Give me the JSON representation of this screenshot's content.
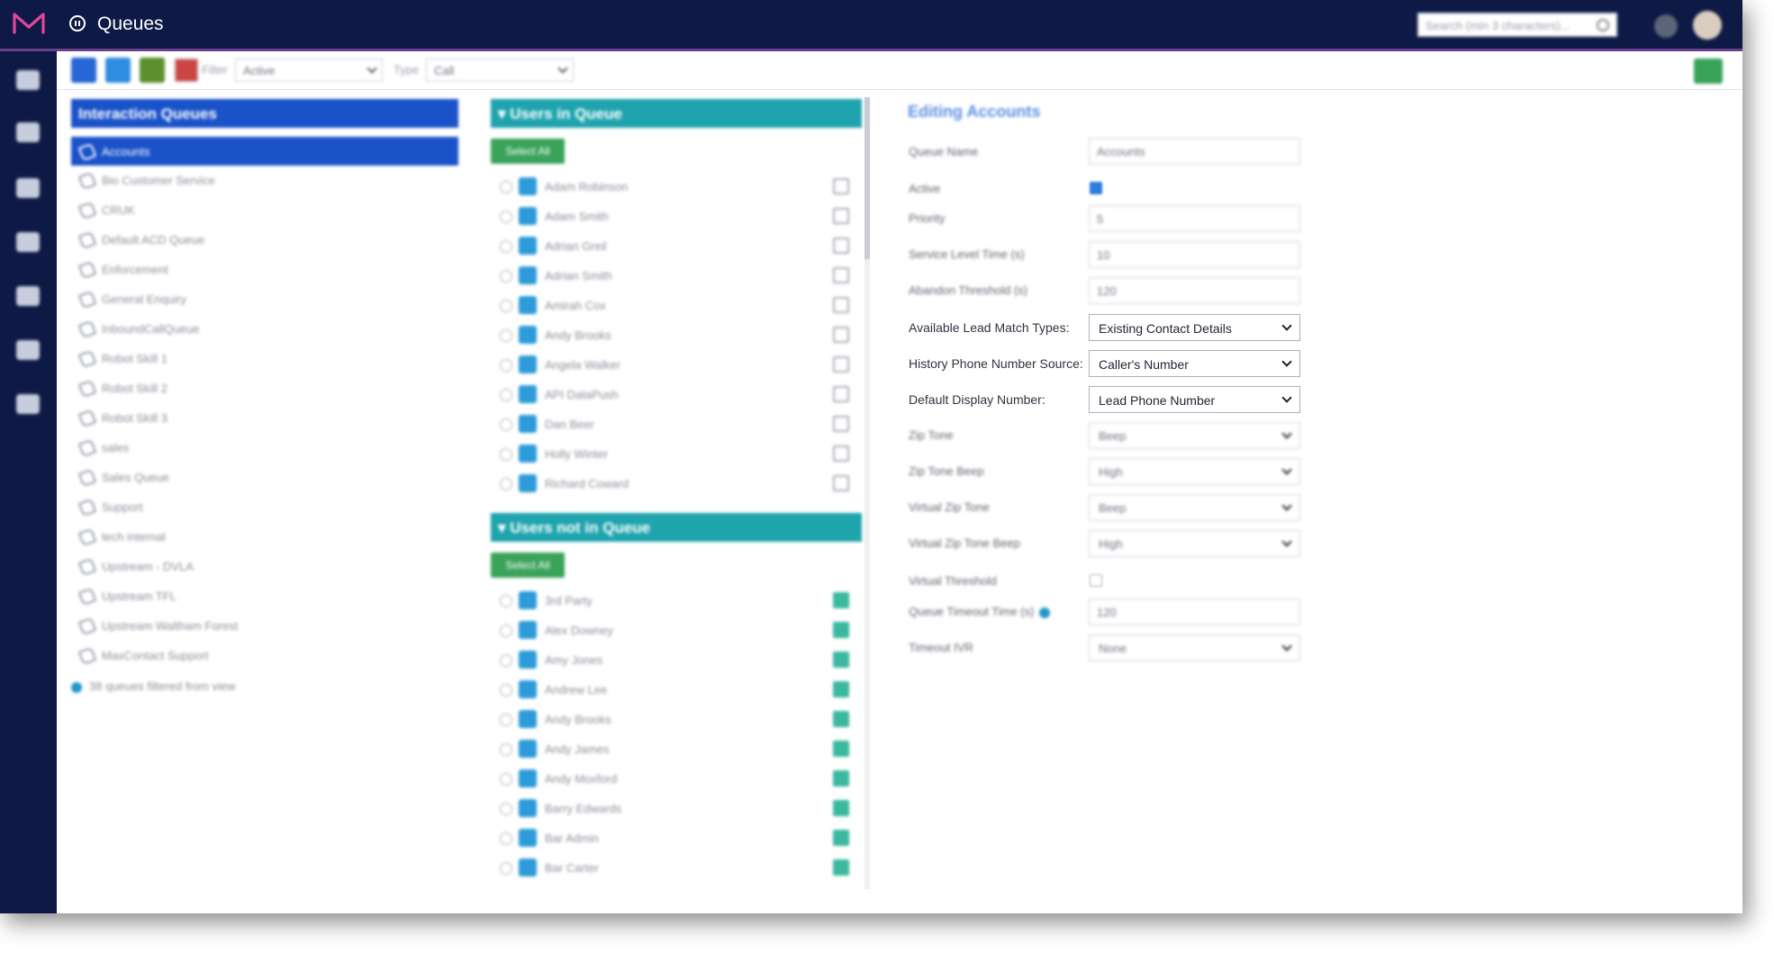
{
  "app": {
    "title": "Queues"
  },
  "search": {
    "placeholder": "Search (min 3 characters)..."
  },
  "toolbar": {
    "filter_label": "Filter",
    "filter_value": "Active",
    "type_label": "Type",
    "type_value": "Call"
  },
  "queues": {
    "header": "Interaction Queues",
    "items": [
      "Accounts",
      "Bio Customer Service",
      "CRUK",
      "Default ACD Queue",
      "Enforcement",
      "General Enquiry",
      "InboundCallQueue",
      "Robot Skill 1",
      "Robot Skill 2",
      "Robot Skill 3",
      "sales",
      "Sales Queue",
      "Support",
      "tech internal",
      "Upstream - DVLA",
      "Upstream TFL",
      "Upstream Waltham Forest",
      "MaxContact Support"
    ],
    "filtered_note": "38 queues filtered from view"
  },
  "users_in_queue": {
    "header": "Users in Queue",
    "select_all": "Select All",
    "users": [
      "Adam Robinson",
      "Adam Smith",
      "Adrian Greil",
      "Adrian Smith",
      "Amirah Cox",
      "Andy Brooks",
      "Angela Walker",
      "API DataPush",
      "Dan Beer",
      "Holly Winter",
      "Richard Coward"
    ]
  },
  "users_not_in_queue": {
    "header": "Users not in Queue",
    "select_all": "Select All",
    "users": [
      "3rd Party",
      "Alex Downey",
      "Amy Jones",
      "Andrew Lee",
      "Andy Brooks",
      "Andy James",
      "Andy Moxford",
      "Barry Edwards",
      "Bar Admin",
      "Bar Carter"
    ]
  },
  "edit": {
    "title": "Editing Accounts",
    "queue_name_label": "Queue Name",
    "queue_name": "Accounts",
    "active_label": "Active",
    "priority_label": "Priority",
    "priority": "5",
    "service_level_label": "Service Level Time (s)",
    "service_level": "10",
    "abandon_label": "Abandon Threshold (s)",
    "abandon": "120",
    "lead_match_label": "Available Lead Match Types:",
    "lead_match": "Existing Contact Details",
    "history_source_label": "History Phone Number Source:",
    "history_source": "Caller's Number",
    "display_number_label": "Default Display Number:",
    "display_number": "Lead Phone Number",
    "zip_tone_label": "Zip Tone",
    "zip_tone": "Beep",
    "zip_tone_beep_label": "Zip Tone Beep",
    "zip_tone_beep": "High",
    "virtual_zip_tone_label": "Virtual Zip Tone",
    "virtual_zip_tone": "Beep",
    "virtual_zip_tone_beep_label": "Virtual Zip Tone Beep",
    "virtual_zip_tone_beep": "High",
    "virtual_threshold_label": "Virtual Threshold",
    "queue_timeout_label": "Queue Timeout Time (s)",
    "queue_timeout": "120",
    "timeout_ivr_label": "Timeout IVR",
    "timeout_ivr": "None"
  },
  "colors": {
    "topbar": "#0e1a45",
    "accent_blue": "#1a52c9",
    "teal_header": "#1fa4ae",
    "green": "#3aa35a"
  }
}
